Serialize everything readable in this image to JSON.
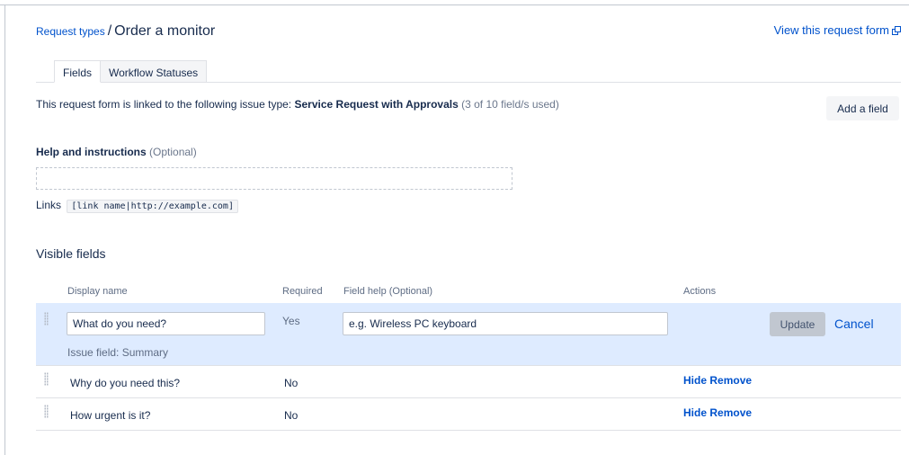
{
  "breadcrumb": {
    "parent": "Request types",
    "separator": "/",
    "title": "Order a monitor"
  },
  "header": {
    "view_form_link": "View this request form"
  },
  "tabs": [
    {
      "label": "Fields",
      "active": true
    },
    {
      "label": "Workflow Statuses",
      "active": false
    }
  ],
  "linked_info": {
    "prefix": "This request form is linked to the following issue type:",
    "issue_type": "Service Request with Approvals",
    "usage": "(3 of 10 field/s used)"
  },
  "add_field_button": "Add a field",
  "help_section": {
    "label": "Help and instructions",
    "optional": "(Optional)",
    "value": ""
  },
  "links": {
    "label": "Links",
    "syntax": "[link name|http://example.com]"
  },
  "visible_fields": {
    "title": "Visible fields",
    "columns": {
      "display_name": "Display name",
      "required": "Required",
      "field_help": "Field help (Optional)",
      "actions": "Actions"
    },
    "editing_row": {
      "display_name_value": "What do you need?",
      "issue_field": "Issue field: Summary",
      "required": "Yes",
      "field_help_placeholder": "e.g. Wireless PC keyboard",
      "update_button": "Update",
      "cancel_link": "Cancel"
    },
    "rows": [
      {
        "name": "Why do you need this?",
        "required": "No",
        "hide": "Hide",
        "remove": "Remove"
      },
      {
        "name": "How urgent is it?",
        "required": "No",
        "hide": "Hide",
        "remove": "Remove"
      }
    ]
  },
  "colors": {
    "link": "#0052cc",
    "text": "#172b4d",
    "editing_row_bg": "#deebff",
    "button_bg": "#f4f5f7"
  }
}
